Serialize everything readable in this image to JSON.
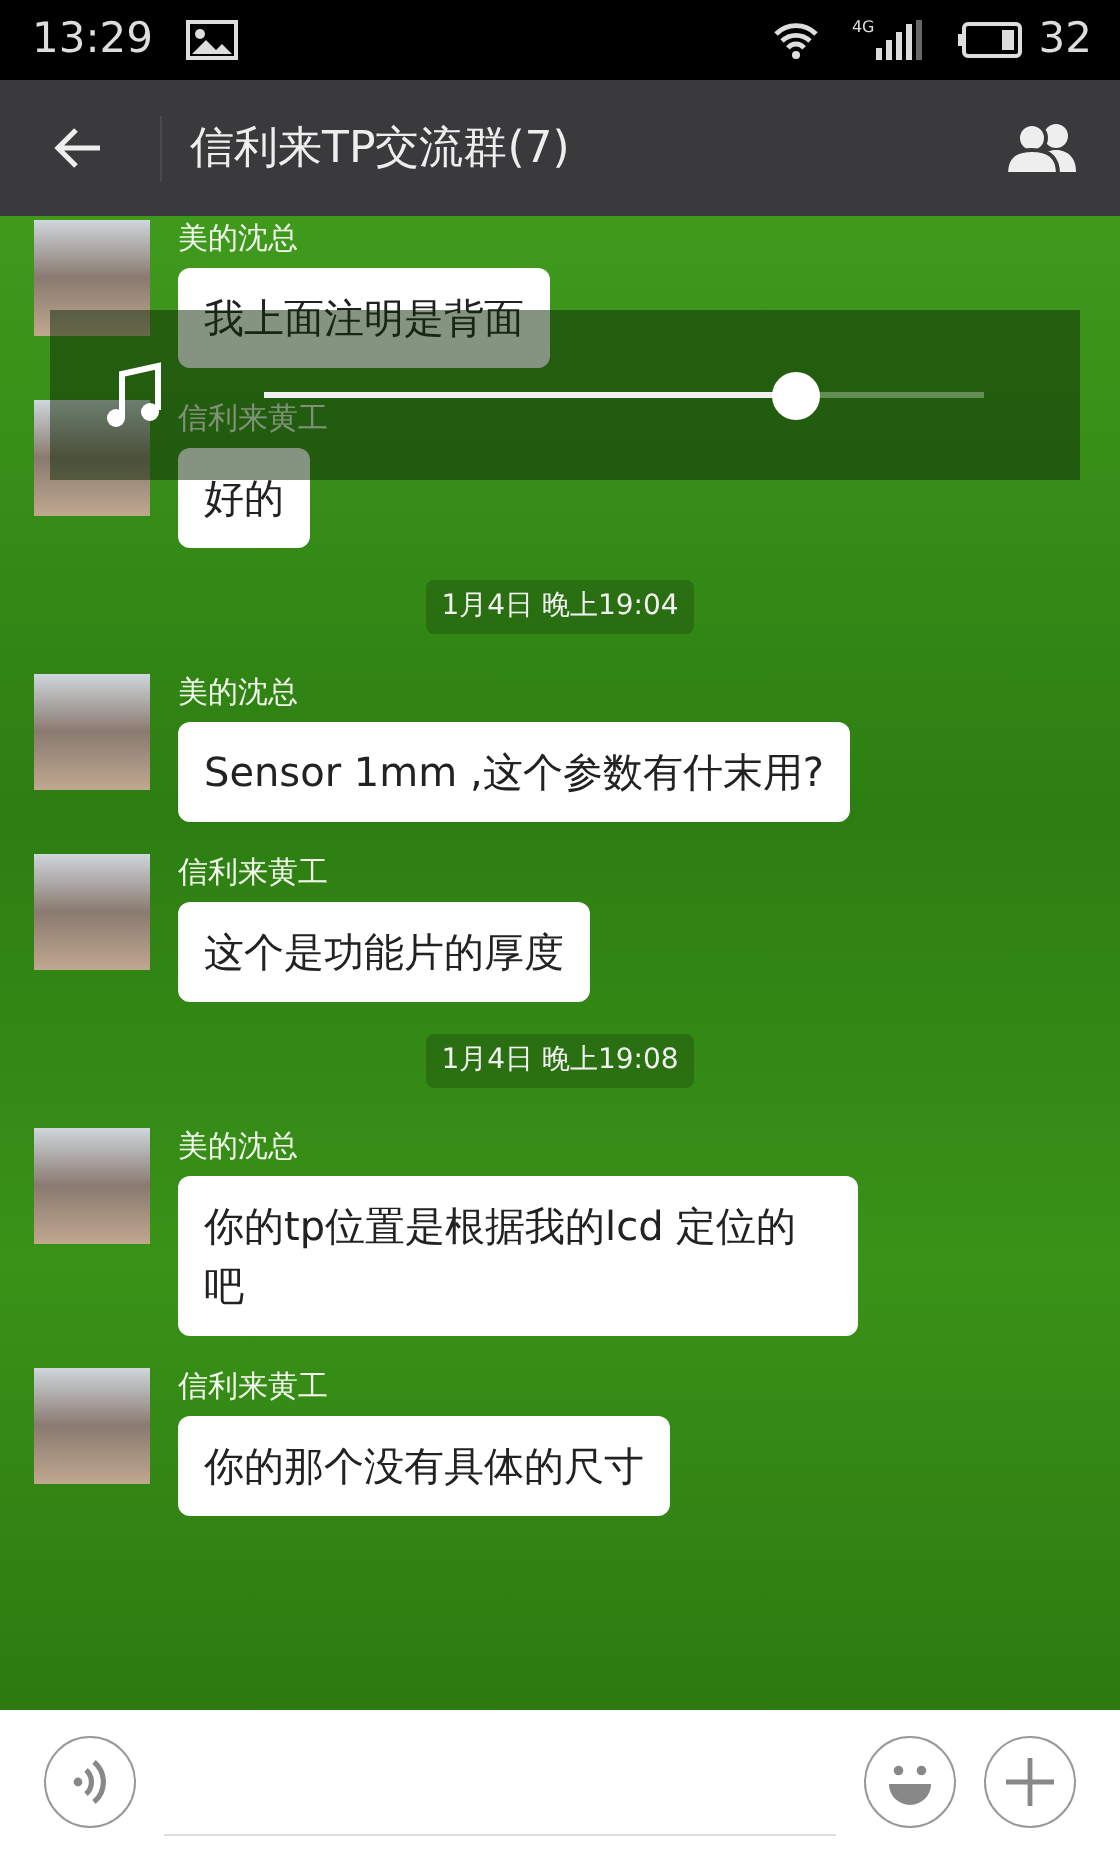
{
  "status_bar": {
    "time": "13:29",
    "network": "4G",
    "battery": "32"
  },
  "header": {
    "title": "信利来TP交流群(7)"
  },
  "messages": [
    {
      "kind": "message",
      "sender": "美的沈总",
      "text": "我上面注明是背面"
    },
    {
      "kind": "message",
      "sender": "信利来黄工",
      "text": "好的"
    },
    {
      "kind": "time",
      "text": "1月4日 晚上19:04"
    },
    {
      "kind": "message",
      "sender": "美的沈总",
      "text": "Sensor 1mm ,这个参数有什末用?"
    },
    {
      "kind": "message",
      "sender": "信利来黄工",
      "text": "这个是功能片的厚度"
    },
    {
      "kind": "time",
      "text": "1月4日 晚上19:08"
    },
    {
      "kind": "message",
      "sender": "美的沈总",
      "text": "你的tp位置是根据我的lcd 定位的吧"
    },
    {
      "kind": "message",
      "sender": "信利来黄工",
      "text": "你的那个没有具体的尺寸"
    }
  ],
  "volume_overlay": {
    "level": 0.74
  }
}
